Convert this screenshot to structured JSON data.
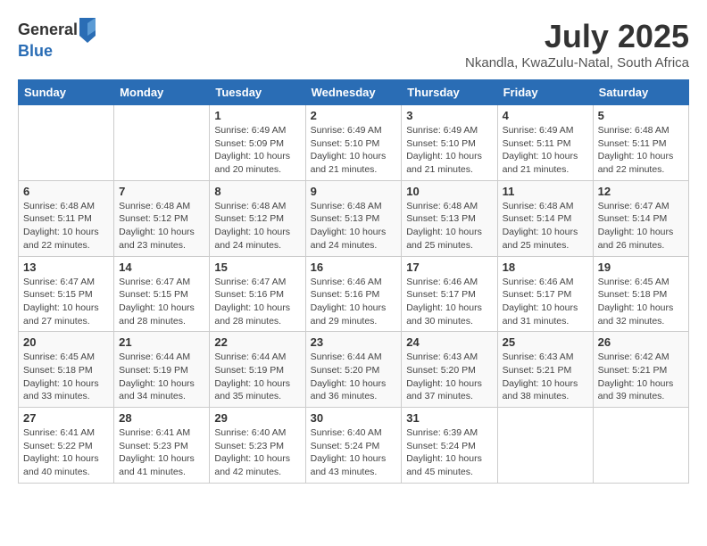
{
  "logo": {
    "general": "General",
    "blue": "Blue"
  },
  "title": "July 2025",
  "location": "Nkandla, KwaZulu-Natal, South Africa",
  "weekdays": [
    "Sunday",
    "Monday",
    "Tuesday",
    "Wednesday",
    "Thursday",
    "Friday",
    "Saturday"
  ],
  "weeks": [
    [
      {
        "day": "",
        "info": ""
      },
      {
        "day": "",
        "info": ""
      },
      {
        "day": "1",
        "info": "Sunrise: 6:49 AM\nSunset: 5:09 PM\nDaylight: 10 hours and 20 minutes."
      },
      {
        "day": "2",
        "info": "Sunrise: 6:49 AM\nSunset: 5:10 PM\nDaylight: 10 hours and 21 minutes."
      },
      {
        "day": "3",
        "info": "Sunrise: 6:49 AM\nSunset: 5:10 PM\nDaylight: 10 hours and 21 minutes."
      },
      {
        "day": "4",
        "info": "Sunrise: 6:49 AM\nSunset: 5:11 PM\nDaylight: 10 hours and 21 minutes."
      },
      {
        "day": "5",
        "info": "Sunrise: 6:48 AM\nSunset: 5:11 PM\nDaylight: 10 hours and 22 minutes."
      }
    ],
    [
      {
        "day": "6",
        "info": "Sunrise: 6:48 AM\nSunset: 5:11 PM\nDaylight: 10 hours and 22 minutes."
      },
      {
        "day": "7",
        "info": "Sunrise: 6:48 AM\nSunset: 5:12 PM\nDaylight: 10 hours and 23 minutes."
      },
      {
        "day": "8",
        "info": "Sunrise: 6:48 AM\nSunset: 5:12 PM\nDaylight: 10 hours and 24 minutes."
      },
      {
        "day": "9",
        "info": "Sunrise: 6:48 AM\nSunset: 5:13 PM\nDaylight: 10 hours and 24 minutes."
      },
      {
        "day": "10",
        "info": "Sunrise: 6:48 AM\nSunset: 5:13 PM\nDaylight: 10 hours and 25 minutes."
      },
      {
        "day": "11",
        "info": "Sunrise: 6:48 AM\nSunset: 5:14 PM\nDaylight: 10 hours and 25 minutes."
      },
      {
        "day": "12",
        "info": "Sunrise: 6:47 AM\nSunset: 5:14 PM\nDaylight: 10 hours and 26 minutes."
      }
    ],
    [
      {
        "day": "13",
        "info": "Sunrise: 6:47 AM\nSunset: 5:15 PM\nDaylight: 10 hours and 27 minutes."
      },
      {
        "day": "14",
        "info": "Sunrise: 6:47 AM\nSunset: 5:15 PM\nDaylight: 10 hours and 28 minutes."
      },
      {
        "day": "15",
        "info": "Sunrise: 6:47 AM\nSunset: 5:16 PM\nDaylight: 10 hours and 28 minutes."
      },
      {
        "day": "16",
        "info": "Sunrise: 6:46 AM\nSunset: 5:16 PM\nDaylight: 10 hours and 29 minutes."
      },
      {
        "day": "17",
        "info": "Sunrise: 6:46 AM\nSunset: 5:17 PM\nDaylight: 10 hours and 30 minutes."
      },
      {
        "day": "18",
        "info": "Sunrise: 6:46 AM\nSunset: 5:17 PM\nDaylight: 10 hours and 31 minutes."
      },
      {
        "day": "19",
        "info": "Sunrise: 6:45 AM\nSunset: 5:18 PM\nDaylight: 10 hours and 32 minutes."
      }
    ],
    [
      {
        "day": "20",
        "info": "Sunrise: 6:45 AM\nSunset: 5:18 PM\nDaylight: 10 hours and 33 minutes."
      },
      {
        "day": "21",
        "info": "Sunrise: 6:44 AM\nSunset: 5:19 PM\nDaylight: 10 hours and 34 minutes."
      },
      {
        "day": "22",
        "info": "Sunrise: 6:44 AM\nSunset: 5:19 PM\nDaylight: 10 hours and 35 minutes."
      },
      {
        "day": "23",
        "info": "Sunrise: 6:44 AM\nSunset: 5:20 PM\nDaylight: 10 hours and 36 minutes."
      },
      {
        "day": "24",
        "info": "Sunrise: 6:43 AM\nSunset: 5:20 PM\nDaylight: 10 hours and 37 minutes."
      },
      {
        "day": "25",
        "info": "Sunrise: 6:43 AM\nSunset: 5:21 PM\nDaylight: 10 hours and 38 minutes."
      },
      {
        "day": "26",
        "info": "Sunrise: 6:42 AM\nSunset: 5:21 PM\nDaylight: 10 hours and 39 minutes."
      }
    ],
    [
      {
        "day": "27",
        "info": "Sunrise: 6:41 AM\nSunset: 5:22 PM\nDaylight: 10 hours and 40 minutes."
      },
      {
        "day": "28",
        "info": "Sunrise: 6:41 AM\nSunset: 5:23 PM\nDaylight: 10 hours and 41 minutes."
      },
      {
        "day": "29",
        "info": "Sunrise: 6:40 AM\nSunset: 5:23 PM\nDaylight: 10 hours and 42 minutes."
      },
      {
        "day": "30",
        "info": "Sunrise: 6:40 AM\nSunset: 5:24 PM\nDaylight: 10 hours and 43 minutes."
      },
      {
        "day": "31",
        "info": "Sunrise: 6:39 AM\nSunset: 5:24 PM\nDaylight: 10 hours and 45 minutes."
      },
      {
        "day": "",
        "info": ""
      },
      {
        "day": "",
        "info": ""
      }
    ]
  ]
}
